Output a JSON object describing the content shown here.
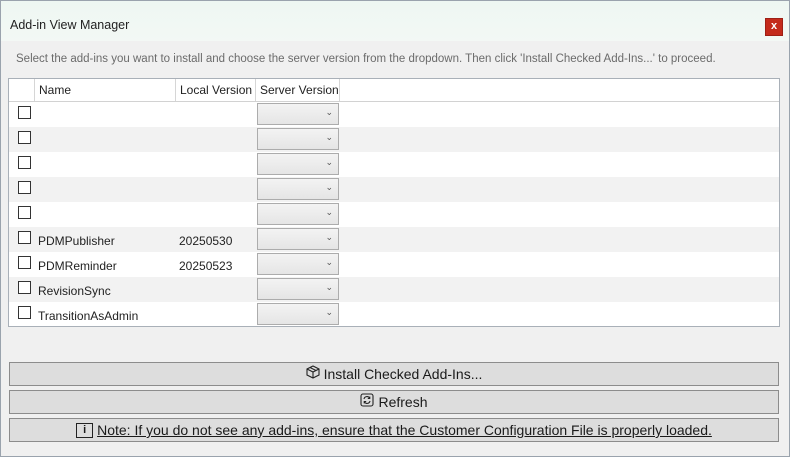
{
  "window": {
    "title": "Add-in View Manager",
    "close_label": "x"
  },
  "instructions": "Select the add-ins you want to install and choose the server version from the dropdown. Then click 'Install Checked Add-Ins...' to proceed.",
  "grid": {
    "columns": [
      "Name",
      "Local Version",
      "Server Version"
    ],
    "rows": [
      {
        "name": "",
        "local_version": "",
        "checked": false
      },
      {
        "name": "",
        "local_version": "",
        "checked": false
      },
      {
        "name": "",
        "local_version": "",
        "checked": false
      },
      {
        "name": "",
        "local_version": "",
        "checked": false
      },
      {
        "name": "",
        "local_version": "",
        "checked": false
      },
      {
        "name": "PDMPublisher",
        "local_version": "20250530",
        "checked": false
      },
      {
        "name": "PDMReminder",
        "local_version": "20250523",
        "checked": false
      },
      {
        "name": "RevisionSync",
        "local_version": "",
        "checked": false
      },
      {
        "name": "TransitionAsAdmin",
        "local_version": "",
        "checked": false
      }
    ]
  },
  "buttons": {
    "install": "Install Checked Add-Ins...",
    "refresh": "Refresh",
    "note": "Note: If you do not see any add-ins, ensure that the Customer Configuration File is properly loaded.",
    "note_icon_glyph": "i"
  },
  "icons": {
    "install": "package-icon",
    "refresh": "refresh-icon",
    "note": "info-icon"
  },
  "colors": {
    "close_button": "#c42b1c",
    "titlebar": "#eef7f2",
    "alt_row": "#f2f2f2"
  }
}
